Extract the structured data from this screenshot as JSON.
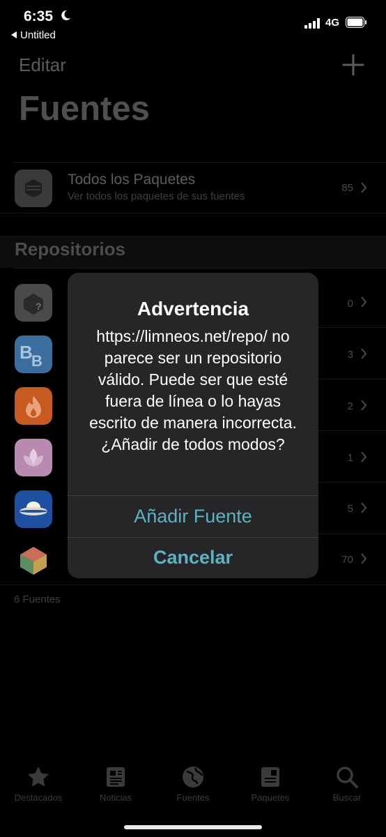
{
  "status_bar": {
    "time": "6:35",
    "network": "4G",
    "back_app": "Untitled"
  },
  "nav": {
    "edit_label": "Editar",
    "title": "Fuentes"
  },
  "all_packages": {
    "title": "Todos los Paquetes",
    "subtitle": "Ver todos los paquetes de sus fuentes",
    "count": "85"
  },
  "section_title": "Repositorios",
  "repos": [
    {
      "count": "0",
      "icon": "box-question-icon",
      "color": "#4a4a4c"
    },
    {
      "count": "3",
      "icon": "bb-logo-icon",
      "color": "#3b6d9e"
    },
    {
      "count": "2",
      "icon": "flame-icon",
      "color": "#c65a20"
    },
    {
      "count": "1",
      "icon": "lotus-icon",
      "color": "#b88ab0"
    },
    {
      "count": "5",
      "icon": "ufo-icon",
      "color": "#1f4fa0"
    },
    {
      "count": "70",
      "icon": "rainbow-cube-icon",
      "color": "#000000"
    }
  ],
  "footer_count": "6 Fuentes",
  "alert": {
    "title": "Advertencia",
    "message": "https://limneos.net/repo/ no parece ser un repositorio válido. Puede ser que esté fuera de línea o lo hayas escrito de manera incorrecta. ¿Añadir de todos modos?",
    "add_label": "Añadir Fuente",
    "cancel_label": "Cancelar"
  },
  "tabs": [
    {
      "label": "Destacados",
      "icon": "star-icon"
    },
    {
      "label": "Noticias",
      "icon": "newspaper-icon"
    },
    {
      "label": "Fuentes",
      "icon": "globe-icon"
    },
    {
      "label": "Paquetes",
      "icon": "package-icon"
    },
    {
      "label": "Buscar",
      "icon": "magnifier-icon"
    }
  ]
}
